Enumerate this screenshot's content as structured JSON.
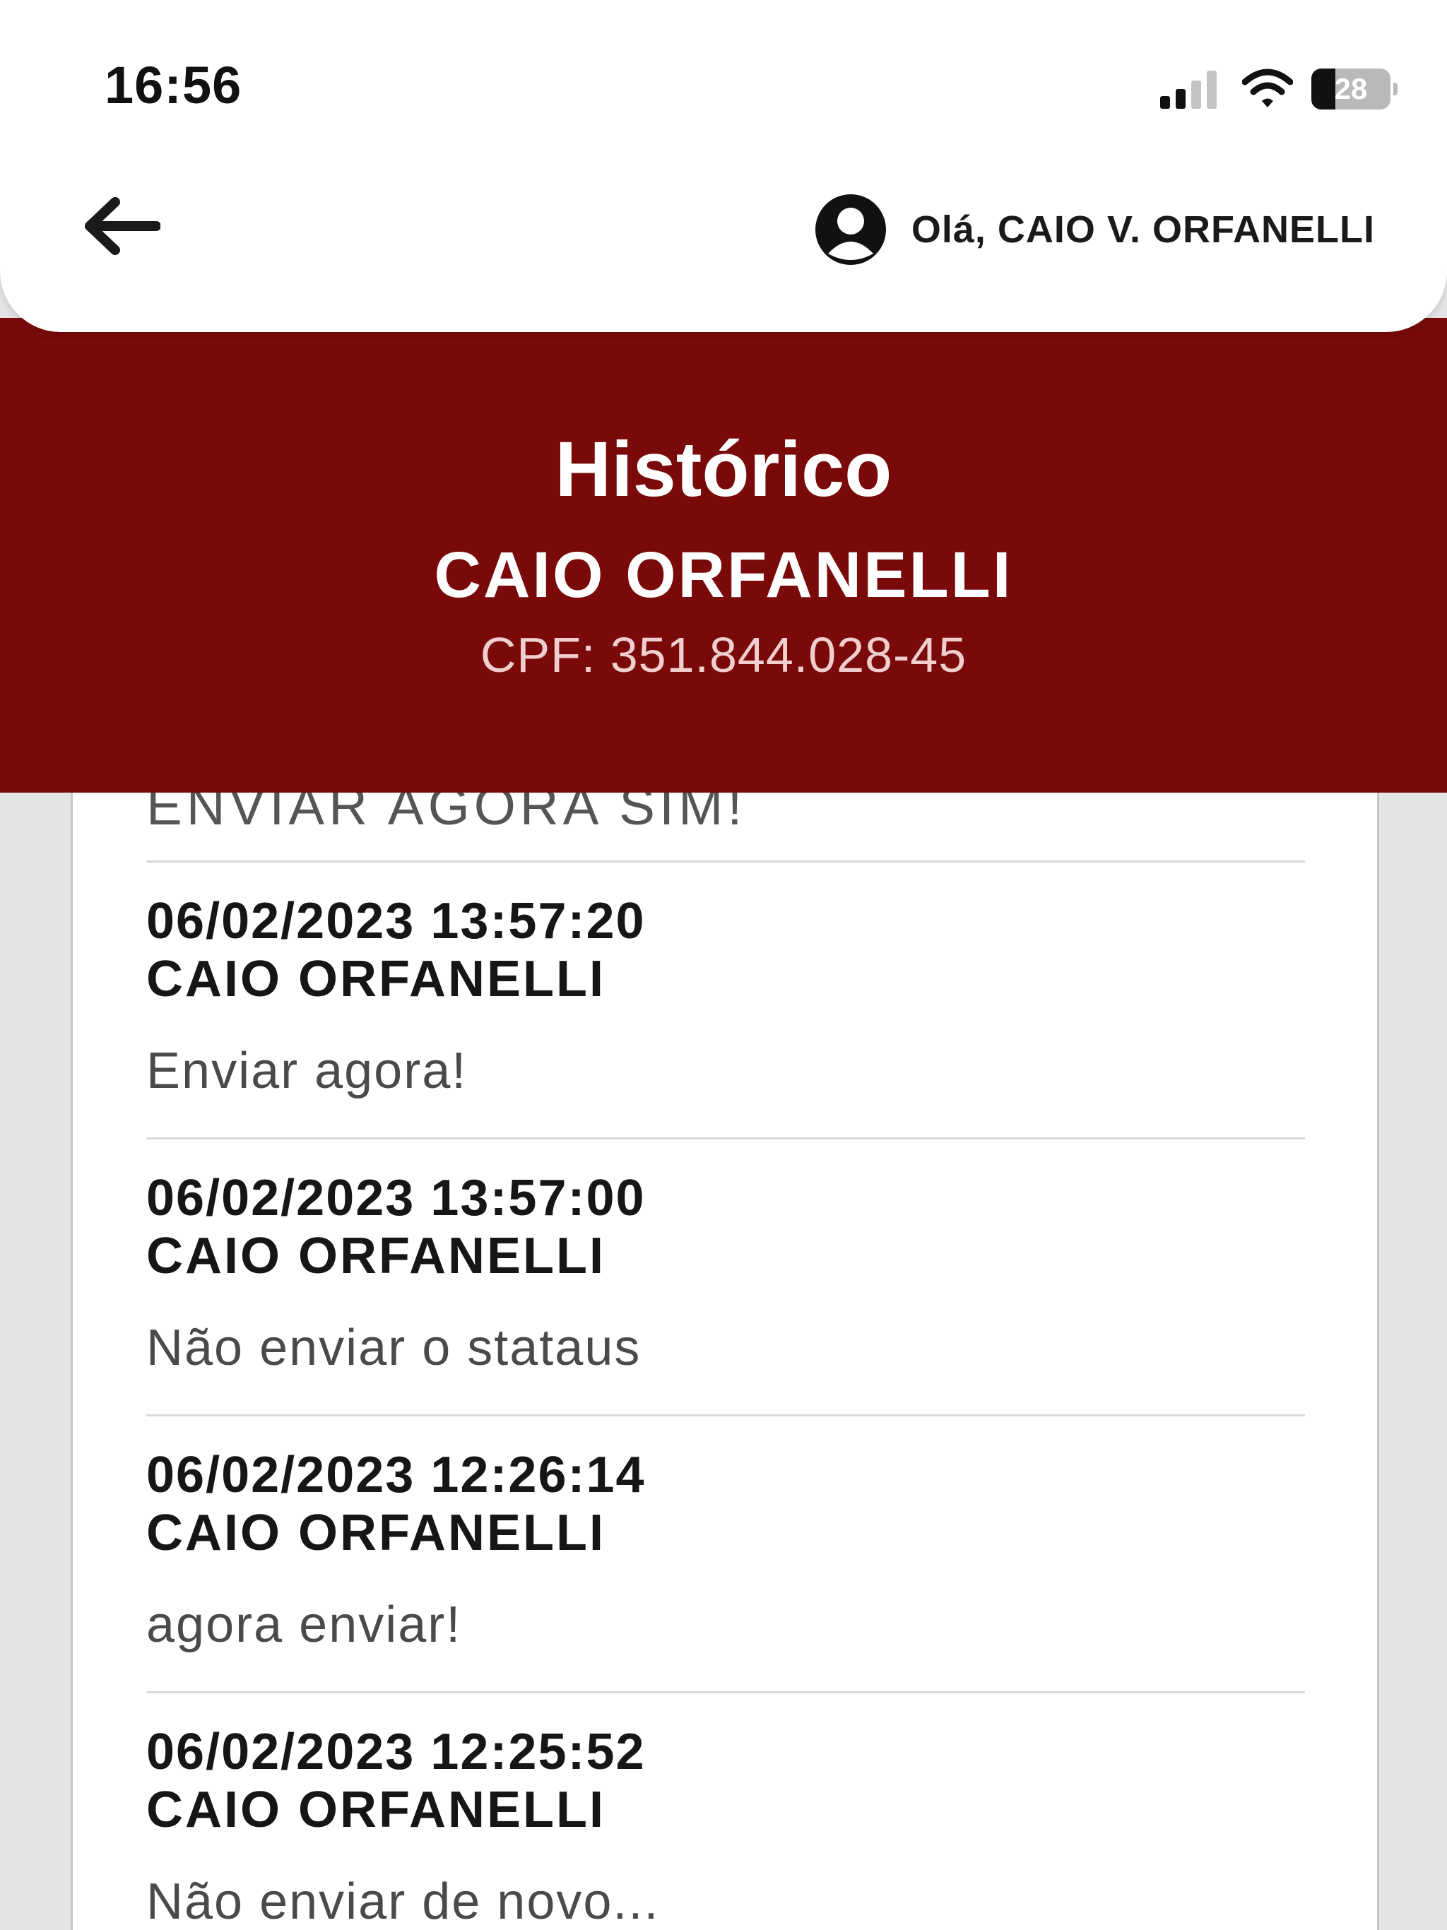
{
  "status_bar": {
    "time": "16:56",
    "battery_level": "28",
    "icons": [
      "cellular-signal-icon",
      "wifi-icon",
      "battery-icon"
    ]
  },
  "header": {
    "back_icon": "arrow-left-icon",
    "user_icon": "user-account-icon",
    "greeting": "Olá, CAIO V. ORFANELLI"
  },
  "banner": {
    "title": "Histórico",
    "customer_name": "CAIO ORFANELLI",
    "cpf": "CPF: 351.844.028-45",
    "background_color": "#7a0909"
  },
  "history": {
    "clipped_entry_text": "ENVIAR AGORA SIM!",
    "entries": [
      {
        "date": "06/02/2023 13:57:20",
        "author": "CAIO ORFANELLI",
        "message": "Enviar agora!"
      },
      {
        "date": "06/02/2023 13:57:00",
        "author": "CAIO ORFANELLI",
        "message": "Não enviar o stataus"
      },
      {
        "date": "06/02/2023 12:26:14",
        "author": "CAIO ORFANELLI",
        "message": "agora enviar!"
      },
      {
        "date": "06/02/2023 12:25:52",
        "author": "CAIO ORFANELLI",
        "message": "Não enviar de novo..."
      }
    ]
  }
}
